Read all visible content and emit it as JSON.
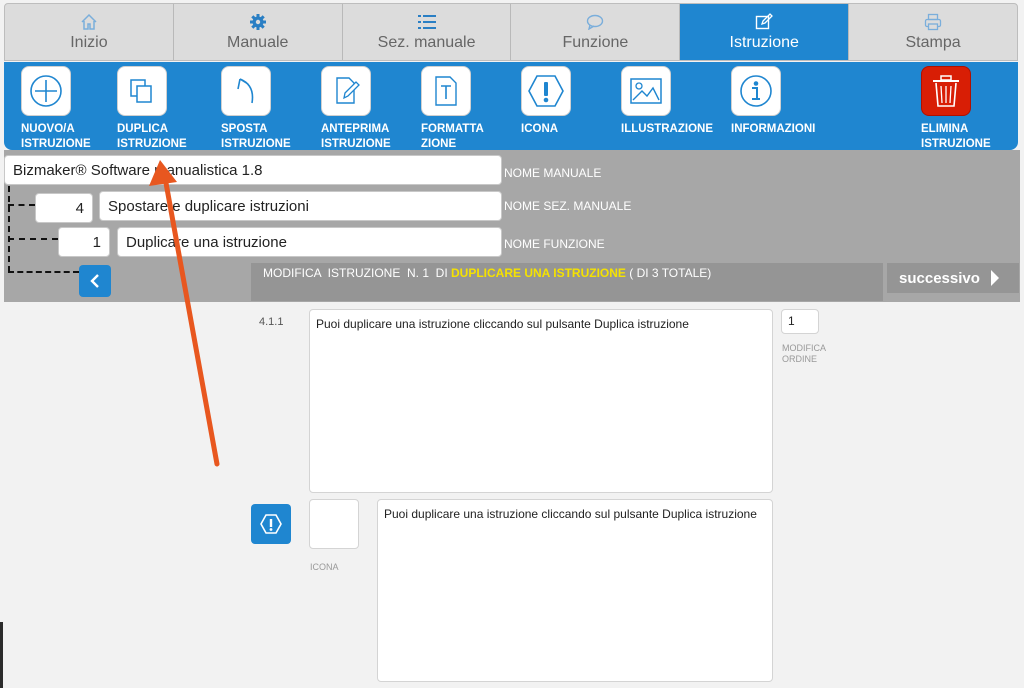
{
  "tabs": [
    {
      "label": "Inizio",
      "icon": "home-icon"
    },
    {
      "label": "Manuale",
      "icon": "gear-icon"
    },
    {
      "label": "Sez. manuale",
      "icon": "list-icon"
    },
    {
      "label": "Funzione",
      "icon": "chat-bubble-icon"
    },
    {
      "label": "Istruzione",
      "icon": "edit-icon",
      "active": true
    },
    {
      "label": "Stampa",
      "icon": "printer-icon"
    }
  ],
  "toolbar": {
    "new": {
      "line1": "NUOVO/A",
      "line2": "ISTRUZIONE"
    },
    "duplicate": {
      "line1": "DUPLICA",
      "line2": "ISTRUZIONE"
    },
    "move": {
      "line1": "SPOSTA",
      "line2": "ISTRUZIONE"
    },
    "preview": {
      "line1": "ANTEPRIMA",
      "line2": "ISTRUZIONE"
    },
    "format": {
      "line1": "FORMATTA",
      "line2": "ZIONE"
    },
    "icon": {
      "line1": "ICONA"
    },
    "illustration": {
      "line1": "ILLUSTRAZIONE"
    },
    "info": {
      "line1": "INFORMAZIONI"
    },
    "delete": {
      "line1": "ELIMINA",
      "line2": "ISTRUZIONE"
    }
  },
  "header": {
    "manual_name": "Bizmaker® Software manualistica 1.8",
    "manual_label": "NOME MANUALE",
    "section_num": "4",
    "section_name": "Spostare e duplicare istruzioni",
    "section_label": "NOME SEZ. MANUALE",
    "function_num": "1",
    "function_name": "Duplicare una istruzione",
    "function_label": "NOME FUNZIONE"
  },
  "modbar": {
    "prefix": "MODIFICA  ISTRUZIONE  N. 1  DI ",
    "highlight": "DUPLICARE UNA ISTRUZIONE",
    "suffix": " ( DI 3 TOTALE)"
  },
  "next_label": "successivo",
  "content": {
    "seq": "4.1.1",
    "instruction_text": "Puoi duplicare una istruzione cliccando sul pulsante Duplica istruzione",
    "order_value": "1",
    "order_label_1": "MODIFICA",
    "order_label_2": "ORDINE",
    "icon_label": "ICONA",
    "icon_text": "Puoi duplicare una istruzione cliccando sul pulsante Duplica istruzione"
  },
  "colors": {
    "accent": "#1f86d0",
    "highlight": "#f5e200",
    "danger": "#d81e05",
    "annotation_arrow": "#e8571f"
  }
}
